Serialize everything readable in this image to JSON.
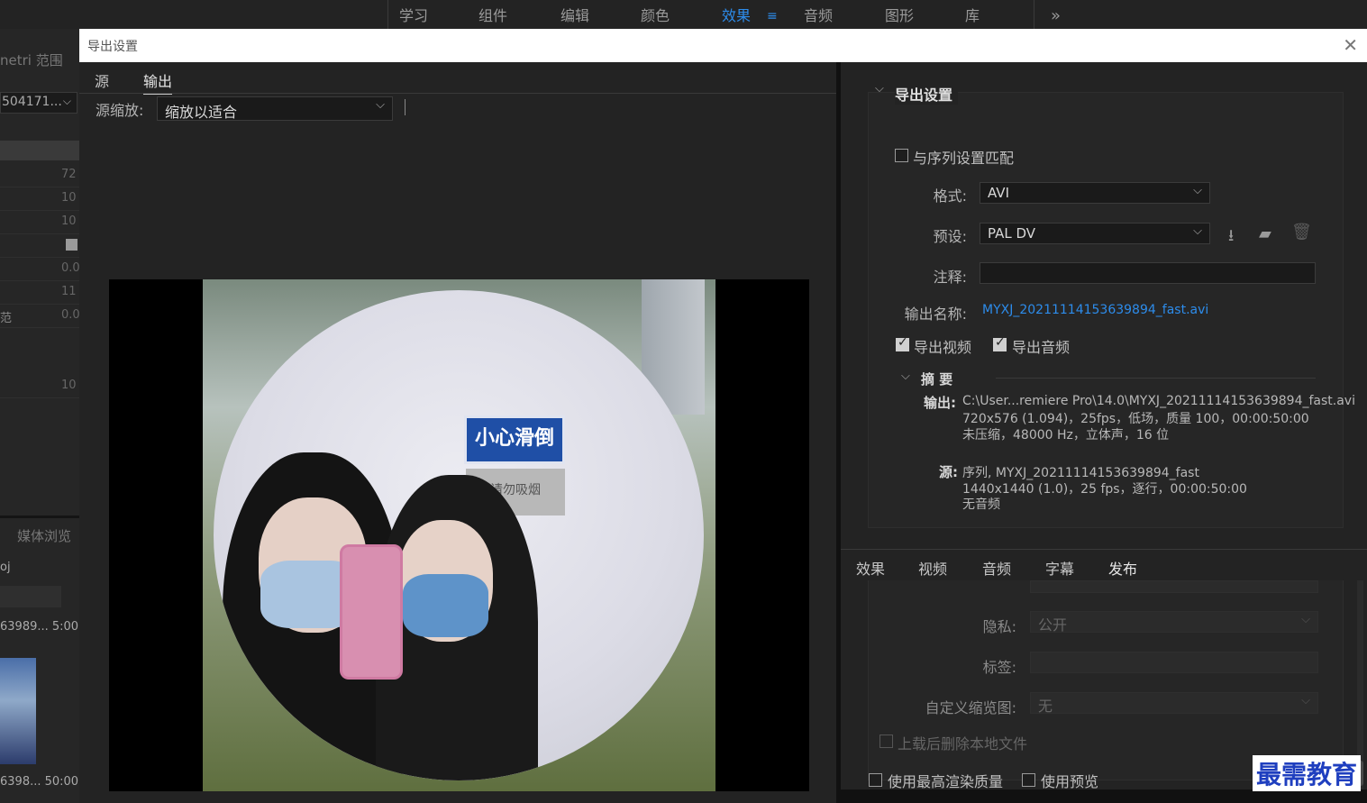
{
  "workspaces": [
    "学习",
    "组件",
    "编辑",
    "颜色",
    "效果",
    "音频",
    "图形",
    "库"
  ],
  "workspace_active": "效果",
  "workspace_more": "»",
  "workspace_menu": "≡",
  "left_panel": {
    "title_fragment": "netri 范围",
    "dropdown_fragment": "504171...",
    "values": [
      "72",
      "10",
      "10",
      "0.0",
      "11",
      "0.0",
      "10"
    ],
    "row_label_fragment": "范",
    "media_browser": "媒体浏览",
    "item_fragment": "oj",
    "clip1": "63989... 5:00",
    "clip2": "6398... 50:00"
  },
  "dialog": {
    "title": "导出设置",
    "close": "✕",
    "left_tabs": [
      "源",
      "输出"
    ],
    "left_tab_active": "输出",
    "source_scale_label": "源缩放:",
    "source_scale_value": "缩放以适合",
    "sign_text": "小心滑倒",
    "sign2_text": "请勿吸烟"
  },
  "export_settings": {
    "section_title": "导出设置",
    "match_sequence": "与序列设置匹配",
    "format_label": "格式:",
    "format_value": "AVI",
    "preset_label": "预设:",
    "preset_value": "PAL DV",
    "comment_label": "注释:",
    "comment_value": "",
    "output_name_label": "输出名称:",
    "output_name_value": "MYXJ_20211114153639894_fast.avi",
    "export_video": "导出视频",
    "export_audio": "导出音频",
    "summary_title": "摘 要",
    "output_key": "输出:",
    "output_lines": [
      "C:\\User...remiere Pro\\14.0\\MYXJ_20211114153639894_fast.avi",
      "720x576 (1.094)，25fps，低场，质量 100，00:00:50:00",
      "未压缩，48000 Hz，立体声，16 位"
    ],
    "source_key": "源:",
    "source_lines": [
      "序列, MYXJ_20211114153639894_fast",
      "1440x1440 (1.0)，25 fps，逐行，00:00:50:00",
      "无音频"
    ]
  },
  "bottom_tabs": [
    "效果",
    "视频",
    "音频",
    "字幕",
    "发布"
  ],
  "bottom_tab_active": "发布",
  "publish": {
    "privacy_label": "隐私:",
    "privacy_value": "公开",
    "tags_label": "标签:",
    "thumbnail_label": "自定义缩览图:",
    "thumbnail_value": "无",
    "delete_local": "上载后删除本地文件"
  },
  "footer": {
    "max_render": "使用最高渲染质量",
    "use_preview": "使用预览"
  },
  "watermark": "最需教育",
  "colors": {
    "accent": "#2d8ceb",
    "background": "#232323",
    "titlebar": "#ffffff"
  }
}
